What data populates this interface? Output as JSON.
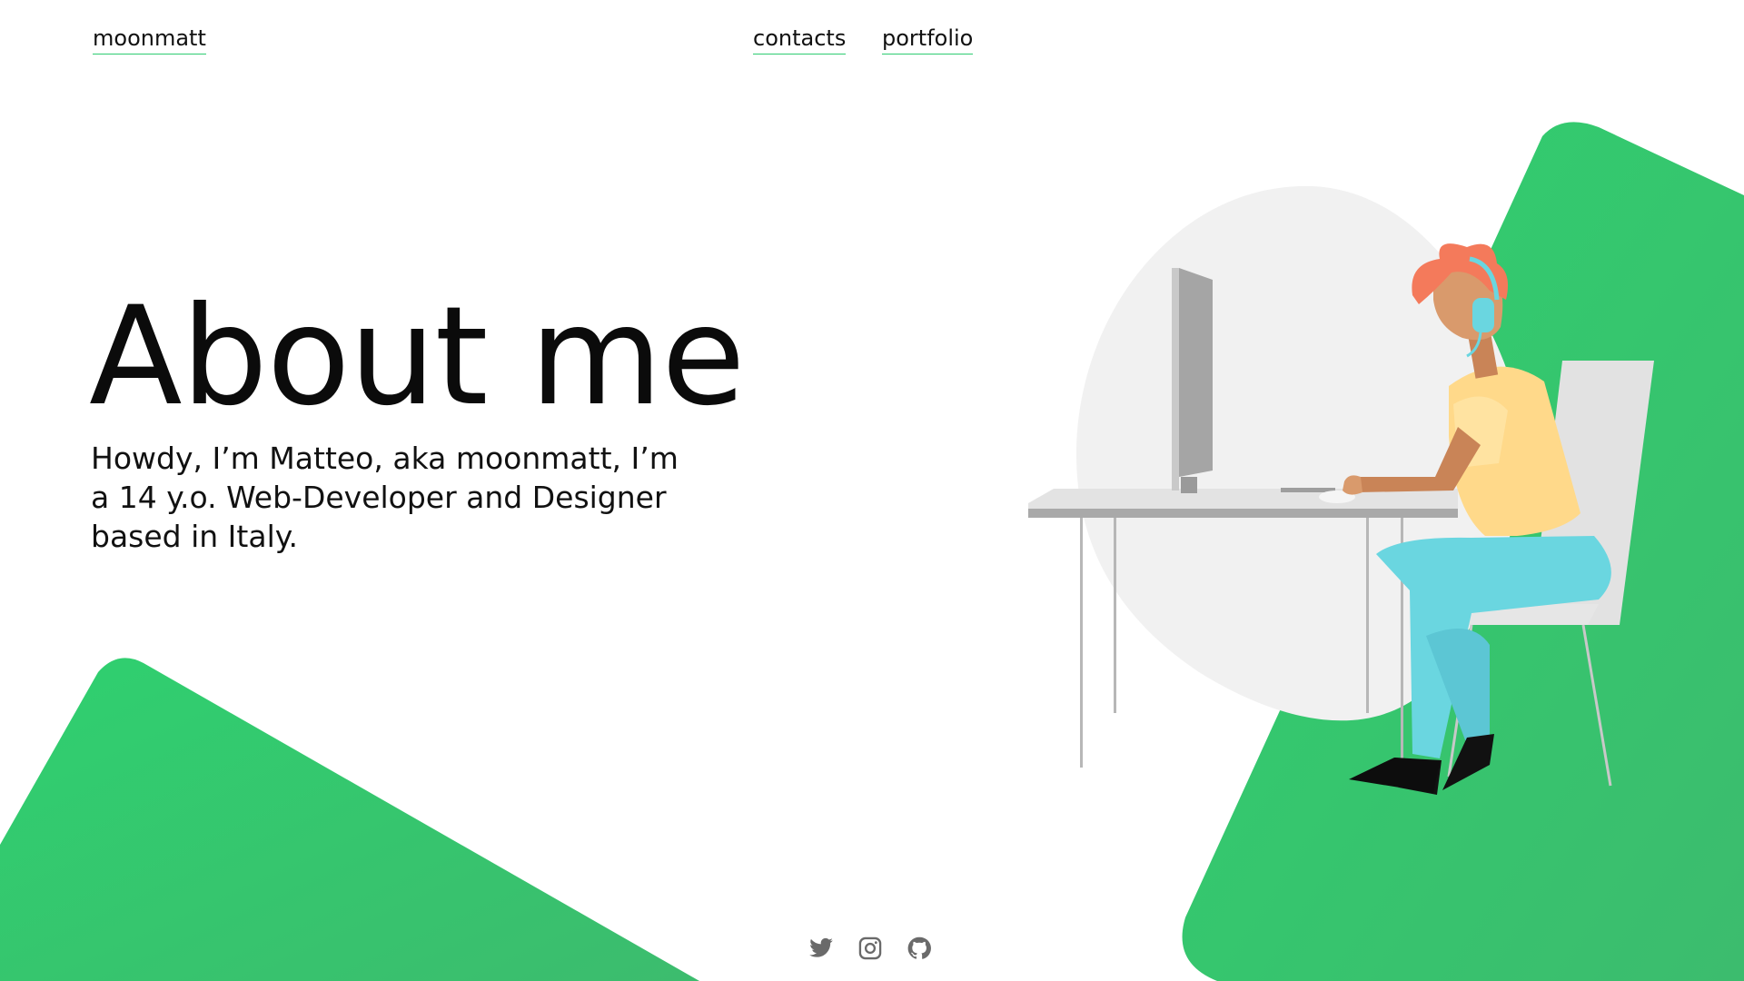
{
  "header": {
    "brand": "moonmatt",
    "nav": [
      {
        "label": "contacts"
      },
      {
        "label": "portfolio"
      }
    ]
  },
  "hero": {
    "title": "About me",
    "text": "Howdy, I’m Matteo, aka moonmatt, I’m a 14 y.o. Web-Developer and Designer based in Italy."
  },
  "socials": [
    {
      "icon": "twitter-icon"
    },
    {
      "icon": "instagram-icon"
    },
    {
      "icon": "github-icon"
    }
  ],
  "colors": {
    "accent": "#2ecc71",
    "shape_green": "#2ecc71",
    "shirt": "#ffd98a",
    "pants": "#6ad6e0",
    "hair": "#f47a5b",
    "skin": "#d99a6c",
    "blob": "#f1f1f1"
  }
}
